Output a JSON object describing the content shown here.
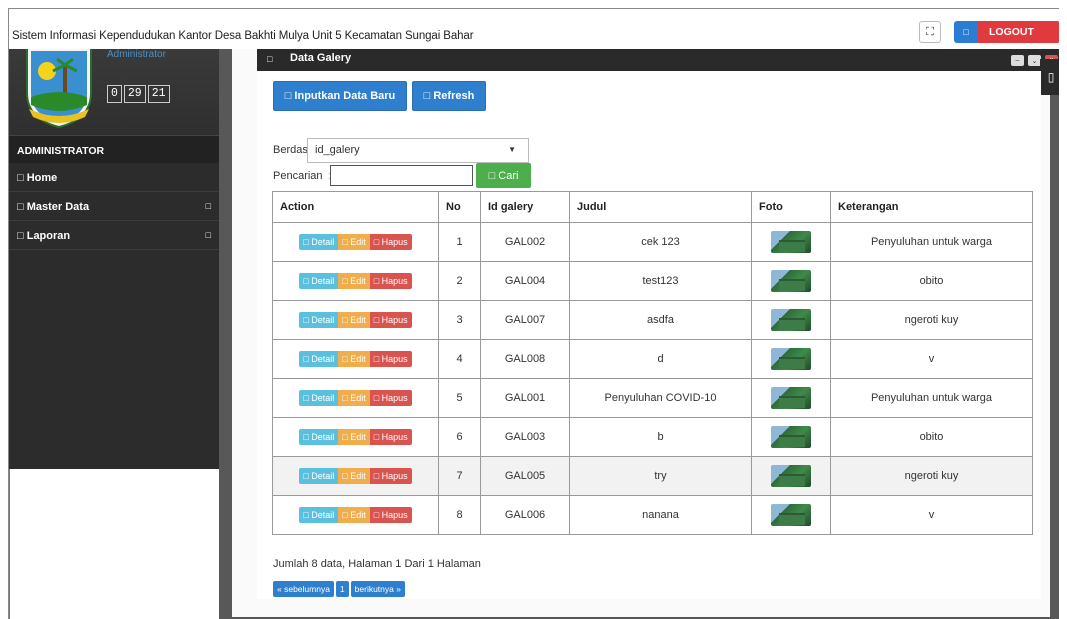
{
  "header": {
    "title": "Sistem Informasi Kependudukan Kantor Desa Bakhti Mulya Unit 5 Kecamatan Sungai Bahar",
    "expand_icon": "fullscreen-icon",
    "logout_icon": "logout-icon",
    "logout_label": "LOGOUT"
  },
  "sidebar": {
    "user_label": "Administrator",
    "clock": {
      "h": "0",
      "m": "29",
      "s": "21"
    },
    "section": "ADMINISTRATOR",
    "items": [
      {
        "label": "Home"
      },
      {
        "label": "Master Data"
      },
      {
        "label": "Laporan"
      }
    ],
    "icon_glyph": "□"
  },
  "panel": {
    "title": "Data Galery",
    "add_button": "□ Inputkan Data Baru",
    "refresh_button": "□ Refresh",
    "filter_label": "Berdasarkan:",
    "filter_value": "id_galery",
    "search_label": "Pencarian",
    "search_value": "",
    "search_button": "□ Cari"
  },
  "table": {
    "headers": [
      "Action",
      "No",
      "Id galery",
      "Judul",
      "Foto",
      "Keterangan"
    ],
    "action_labels": {
      "detail": "□ Detail",
      "edit": "□ Edit",
      "delete": "□ Hapus"
    },
    "rows": [
      {
        "no": "1",
        "id": "GAL002",
        "judul": "cek 123",
        "ket": "Penyuluhan untuk warga"
      },
      {
        "no": "2",
        "id": "GAL004",
        "judul": "test123",
        "ket": "obito"
      },
      {
        "no": "3",
        "id": "GAL007",
        "judul": "asdfa",
        "ket": "ngeroti kuy"
      },
      {
        "no": "4",
        "id": "GAL008",
        "judul": "d",
        "ket": "v"
      },
      {
        "no": "5",
        "id": "GAL001",
        "judul": "Penyuluhan COVID-10",
        "ket": "Penyuluhan untuk warga"
      },
      {
        "no": "6",
        "id": "GAL003",
        "judul": "b",
        "ket": "obito"
      },
      {
        "no": "7",
        "id": "GAL005",
        "judul": "try",
        "ket": "ngeroti kuy"
      },
      {
        "no": "8",
        "id": "GAL006",
        "judul": "nanana",
        "ket": "v"
      }
    ]
  },
  "footer": {
    "summary": "Jumlah 8 data, Halaman 1 Dari 1 Halaman",
    "prev": "« sebelumnya",
    "page": "1",
    "next": "berikutnya »"
  }
}
